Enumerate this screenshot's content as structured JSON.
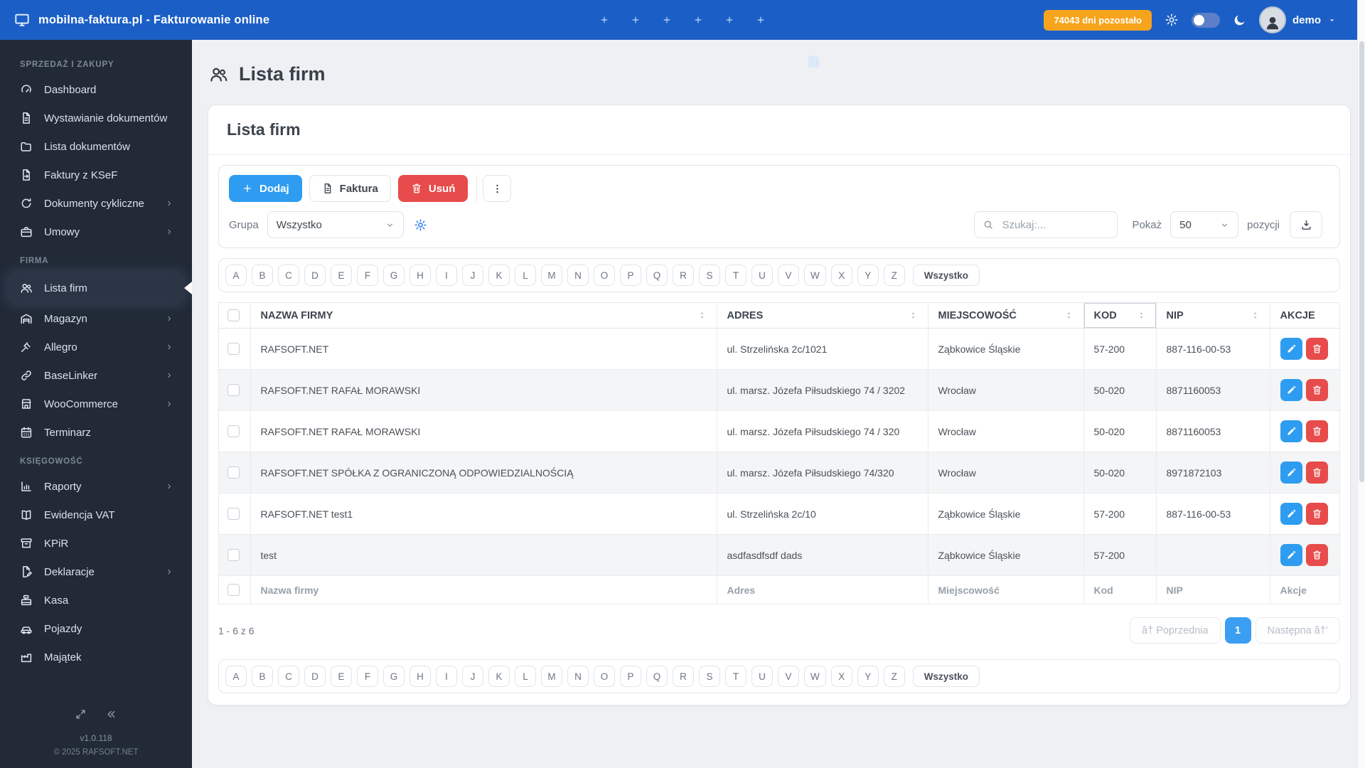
{
  "colors": {
    "topbar": "#1b5fc6",
    "accent": "#2e9cf0",
    "danger": "#e84b4b",
    "badge": "#f6a41c",
    "sidebar": "#212a36"
  },
  "topbar": {
    "title": "mobilna-faktura.pl - Fakturowanie online",
    "badge": "74043 dni pozostało",
    "user": "demo",
    "quick": [
      {
        "name": "document",
        "icon": "file-invoice"
      },
      {
        "name": "order",
        "icon": "cart"
      },
      {
        "name": "contact",
        "icon": "users"
      },
      {
        "name": "product",
        "icon": "box"
      },
      {
        "name": "service",
        "icon": "cloche"
      },
      {
        "name": "event",
        "icon": "calendar"
      }
    ]
  },
  "sidebar": {
    "sections": [
      {
        "label": "SPRZEDAŻ I ZAKUPY",
        "items": [
          {
            "label": "Dashboard",
            "icon": "gauge"
          },
          {
            "label": "Wystawianie dokumentów",
            "icon": "file-invoice"
          },
          {
            "label": "Lista dokumentów",
            "icon": "folder"
          },
          {
            "label": "Faktury z KSeF",
            "icon": "file-export"
          },
          {
            "label": "Dokumenty cykliczne",
            "icon": "refresh",
            "chevron": true
          },
          {
            "label": "Umowy",
            "icon": "briefcase",
            "chevron": true
          }
        ]
      },
      {
        "label": "FIRMA",
        "items": [
          {
            "label": "Lista firm",
            "icon": "users",
            "active": true
          },
          {
            "label": "Magazyn",
            "icon": "warehouse",
            "chevron": true
          },
          {
            "label": "Allegro",
            "icon": "gavel",
            "chevron": true
          },
          {
            "label": "BaseLinker",
            "icon": "link",
            "chevron": true
          },
          {
            "label": "WooCommerce",
            "icon": "store",
            "chevron": true
          },
          {
            "label": "Terminarz",
            "icon": "calendar-days"
          }
        ]
      },
      {
        "label": "KSIĘGOWOŚĆ",
        "items": [
          {
            "label": "Raporty",
            "icon": "chart",
            "chevron": true
          },
          {
            "label": "Ewidencja VAT",
            "icon": "book"
          },
          {
            "label": "KPiR",
            "icon": "archive"
          },
          {
            "label": "Deklaracje",
            "icon": "file-pen",
            "chevron": true
          },
          {
            "label": "Kasa",
            "icon": "cash-register"
          },
          {
            "label": "Pojazdy",
            "icon": "car"
          },
          {
            "label": "Majątek",
            "icon": "factory"
          }
        ]
      }
    ],
    "version": "v1.0.118",
    "copyright": "© 2025 RAFSOFT.NET"
  },
  "page": {
    "title": "Lista firm"
  },
  "card": {
    "title": "Lista firm",
    "toolbar": {
      "add": "Dodaj",
      "invoice": "Faktura",
      "remove": "Usuń"
    },
    "filters": {
      "group_label": "Grupa",
      "group_value": "Wszystko",
      "search_placeholder": "Szukaj:...",
      "show_label": "Pokaż",
      "page_size": "50",
      "suffix": "pozycji"
    },
    "alphabet": {
      "letters": [
        "A",
        "B",
        "C",
        "D",
        "E",
        "F",
        "G",
        "H",
        "I",
        "J",
        "K",
        "L",
        "M",
        "N",
        "O",
        "P",
        "Q",
        "R",
        "S",
        "T",
        "U",
        "V",
        "W",
        "X",
        "Y",
        "Z"
      ],
      "all": "Wszystko"
    },
    "table": {
      "columns": [
        {
          "label": "NAZWA FIRMY",
          "sortable": true
        },
        {
          "label": "ADRES",
          "sortable": true
        },
        {
          "label": "MIEJSCOWOŚĆ",
          "sortable": true
        },
        {
          "label": "KOD",
          "sortable": true,
          "outlined": true
        },
        {
          "label": "NIP",
          "sortable": true
        },
        {
          "label": "AKCJE",
          "sortable": false
        }
      ],
      "rows": [
        {
          "name": "RAFSOFT.NET",
          "address": "ul. Strzelińska 2c/1021",
          "city": "Ząbkowice Śląskie",
          "code": "57-200",
          "nip": "887-116-00-53"
        },
        {
          "name": "RAFSOFT.NET RAFAŁ MORAWSKI",
          "address": "ul. marsz. Józefa Piłsudskiego 74 / 3202",
          "city": "Wrocław",
          "code": "50-020",
          "nip": "8871160053"
        },
        {
          "name": "RAFSOFT.NET RAFAŁ MORAWSKI",
          "address": "ul. marsz. Józefa Piłsudskiego 74 / 320",
          "city": "Wrocław",
          "code": "50-020",
          "nip": "8871160053"
        },
        {
          "name": "RAFSOFT.NET SPÓŁKA Z OGRANICZONĄ ODPOWIEDZIALNOŚCIĄ",
          "address": "ul. marsz. Józefa Piłsudskiego 74/320",
          "city": "Wrocław",
          "code": "50-020",
          "nip": "8971872103"
        },
        {
          "name": "RAFSOFT.NET test1",
          "address": "ul. Strzelińska 2c/10",
          "city": "Ząbkowice Śląskie",
          "code": "57-200",
          "nip": "887-116-00-53"
        },
        {
          "name": "test",
          "address": "asdfasdfsdf dads",
          "city": "Ząbkowice Śląskie",
          "code": "57-200",
          "nip": ""
        }
      ],
      "footer": [
        "Nazwa firmy",
        "Adres",
        "Miejscowość",
        "Kod",
        "NIP",
        "Akcje"
      ]
    },
    "pagination": {
      "info": "1 - 6 z 6",
      "prev": "â† Poprzednia",
      "page": "1",
      "next": "Następna â†’"
    }
  }
}
